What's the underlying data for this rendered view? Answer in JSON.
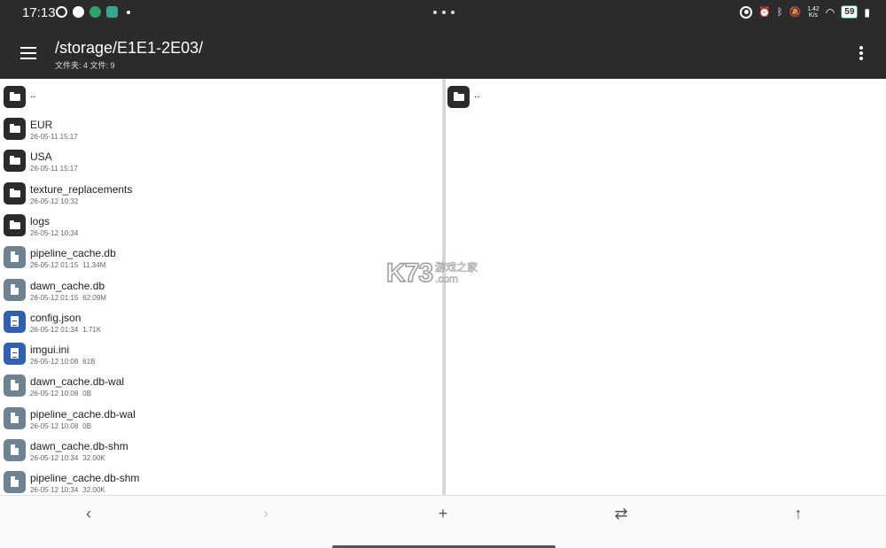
{
  "status_bar": {
    "time": "17:13",
    "net_speed_value": "1.42",
    "net_speed_unit": "K/s",
    "battery": "59",
    "icons": [
      "app-icon-1",
      "app-icon-2",
      "app-icon-3",
      "app-icon-4",
      "record-icon",
      "alarm-icon",
      "bluetooth-icon",
      "mute-bell-icon",
      "wifi-icon",
      "battery-icon",
      "charging-icon"
    ]
  },
  "app_bar": {
    "path": "/storage/E1E1-2E03/",
    "counts": "文件夹: 4  文件: 9"
  },
  "left_pane": {
    "parent_label": "..",
    "items": [
      {
        "name": "EUR",
        "date": "26-05-11 15:17",
        "size": "",
        "type": "folder"
      },
      {
        "name": "USA",
        "date": "26-05-11 15:17",
        "size": "",
        "type": "folder"
      },
      {
        "name": "texture_replacements",
        "date": "26-05-12 10:32",
        "size": "",
        "type": "folder"
      },
      {
        "name": "logs",
        "date": "26-05-12 10:34",
        "size": "",
        "type": "folder"
      },
      {
        "name": "pipeline_cache.db",
        "date": "26-05-12 01:15",
        "size": "11.34M",
        "type": "file"
      },
      {
        "name": "dawn_cache.db",
        "date": "26-05-12 01:15",
        "size": "62.09M",
        "type": "file"
      },
      {
        "name": "config.json",
        "date": "26-05-12 01:34",
        "size": "1.71K",
        "type": "text"
      },
      {
        "name": "imgui.ini",
        "date": "26-05-12 10:08",
        "size": "61B",
        "type": "text"
      },
      {
        "name": "dawn_cache.db-wal",
        "date": "26-05-12 10:08",
        "size": "0B",
        "type": "file"
      },
      {
        "name": "pipeline_cache.db-wal",
        "date": "26-05-12 10:08",
        "size": "0B",
        "type": "file"
      },
      {
        "name": "dawn_cache.db-shm",
        "date": "26-05-12 10:34",
        "size": "32.00K",
        "type": "file"
      },
      {
        "name": "pipeline_cache.db-shm",
        "date": "26-05-12 10:34",
        "size": "32.00K",
        "type": "file"
      }
    ]
  },
  "right_pane": {
    "parent_label": ".."
  },
  "watermark": {
    "main": "K73",
    "sub_top": "游戏之家",
    "sub_bottom": ".com"
  },
  "bottom_bar": {
    "back_icon": "‹",
    "forward_icon": "›",
    "add_icon": "+",
    "swap_icon": "⇄",
    "up_icon": "↑"
  }
}
